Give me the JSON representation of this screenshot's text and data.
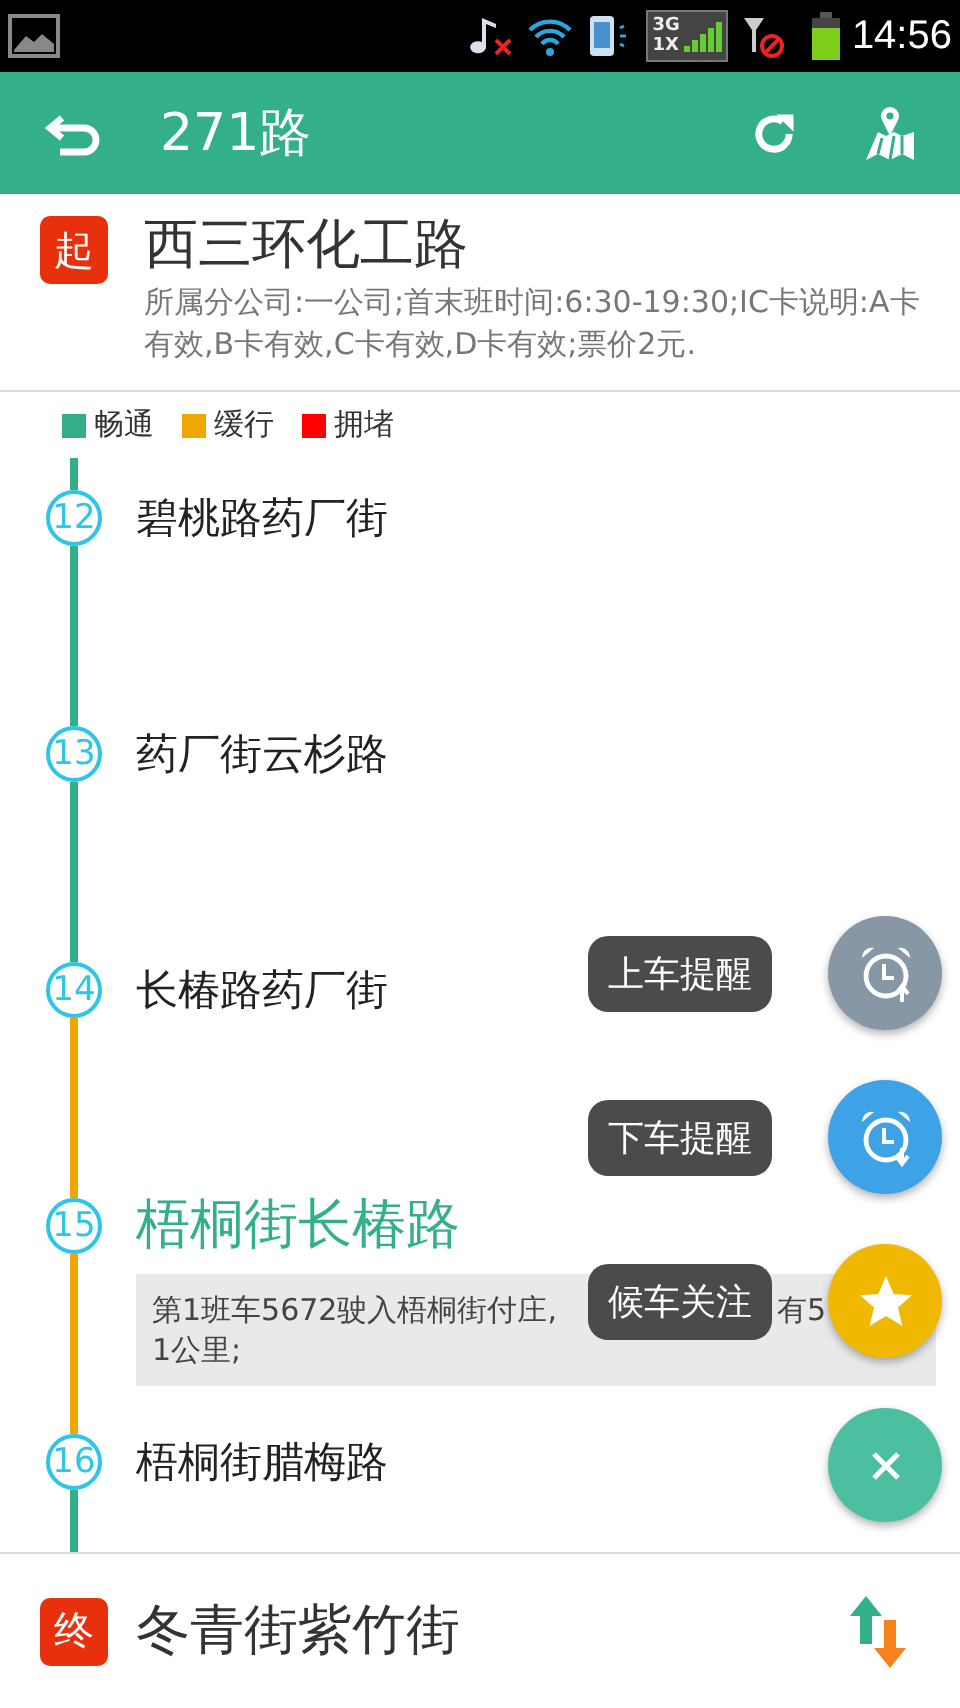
{
  "status_bar": {
    "network_top": "3G",
    "network_bottom": "1X",
    "time": "14:56"
  },
  "header": {
    "title": "271路"
  },
  "start": {
    "badge": "起",
    "name": "西三环化工路",
    "info": "所属分公司:一公司;首末班时间:6:30-19:30;IC卡说明:A卡有效,B卡有效,C卡有效,D卡有效;票价2元."
  },
  "legend": [
    {
      "label": "畅通",
      "color": "#33b08a"
    },
    {
      "label": "缓行",
      "color": "#f0a800"
    },
    {
      "label": "拥堵",
      "color": "#ff0000"
    }
  ],
  "stops": [
    {
      "number": "12",
      "name": "碧桃路药厂街",
      "color": "#33b08a",
      "selected": false
    },
    {
      "number": "13",
      "name": "药厂街云杉路",
      "color": "#33b08a",
      "selected": false
    },
    {
      "number": "14",
      "name": "长椿路药厂街",
      "color": "#f0a800",
      "selected": false
    },
    {
      "number": "15",
      "name": "梧桐街长椿路",
      "color": "#f0a800",
      "selected": true,
      "note": {
        "text": "第1班车5672驶入梧桐街付庄,",
        "text_tail": "有5",
        "line_2": "1公里;"
      }
    },
    {
      "number": "16",
      "name": "梧桐街腊梅路",
      "color": "#33b08a",
      "selected": false
    }
  ],
  "fab_menu": [
    {
      "label": "上车提醒",
      "kind": "alarm_up",
      "color": "#8797a6"
    },
    {
      "label": "下车提醒",
      "kind": "alarm_down",
      "color": "#3ea3e6"
    },
    {
      "label": "候车关注",
      "kind": "star",
      "color": "#f0b800"
    }
  ],
  "end": {
    "badge": "终",
    "name": "冬青街紫竹街"
  }
}
